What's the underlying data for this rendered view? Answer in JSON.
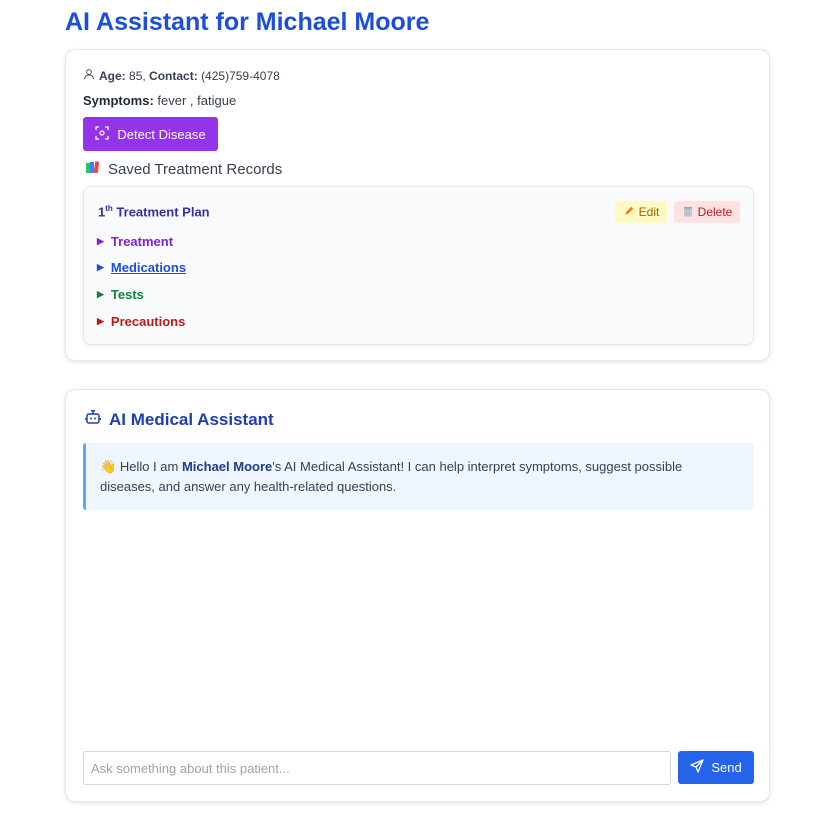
{
  "header": {
    "title": "AI Assistant for Michael Moore"
  },
  "patient": {
    "age_label": "Age:",
    "age_value": "85,",
    "contact_label": "Contact:",
    "contact_value": "(425)759-4078",
    "symptoms_label": "Symptoms:",
    "symptoms_value": "fever , fatigue",
    "detect_button": "Detect Disease"
  },
  "records": {
    "heading": "Saved Treatment Records",
    "plan": {
      "number": "1",
      "ordinal": "th",
      "title": "Treatment Plan",
      "edit_label": "Edit",
      "delete_label": "Delete",
      "items": [
        {
          "label": "Treatment",
          "color": "#7e22ce"
        },
        {
          "label": "Medications",
          "color": "#1d4ed8"
        },
        {
          "label": "Tests",
          "color": "#15803d"
        },
        {
          "label": "Precautions",
          "color": "#b91c1c"
        }
      ]
    }
  },
  "chat": {
    "heading": "AI Medical Assistant",
    "welcome": {
      "prefix": "Hello I am ",
      "name": "Michael Moore",
      "suffix": "'s AI Medical Assistant! I can help interpret symptoms, suggest possible diseases, and answer any health-related questions."
    },
    "input_placeholder": "Ask something about this patient...",
    "send_label": "Send"
  },
  "colors": {
    "accent": "#1d4ed8",
    "detect": "#9333ea",
    "send": "#2563eb"
  },
  "icons": [
    "user-icon",
    "scan-icon",
    "books-icon",
    "pencil-icon",
    "trash-icon",
    "robot-icon",
    "wave-hand-icon",
    "send-icon"
  ]
}
